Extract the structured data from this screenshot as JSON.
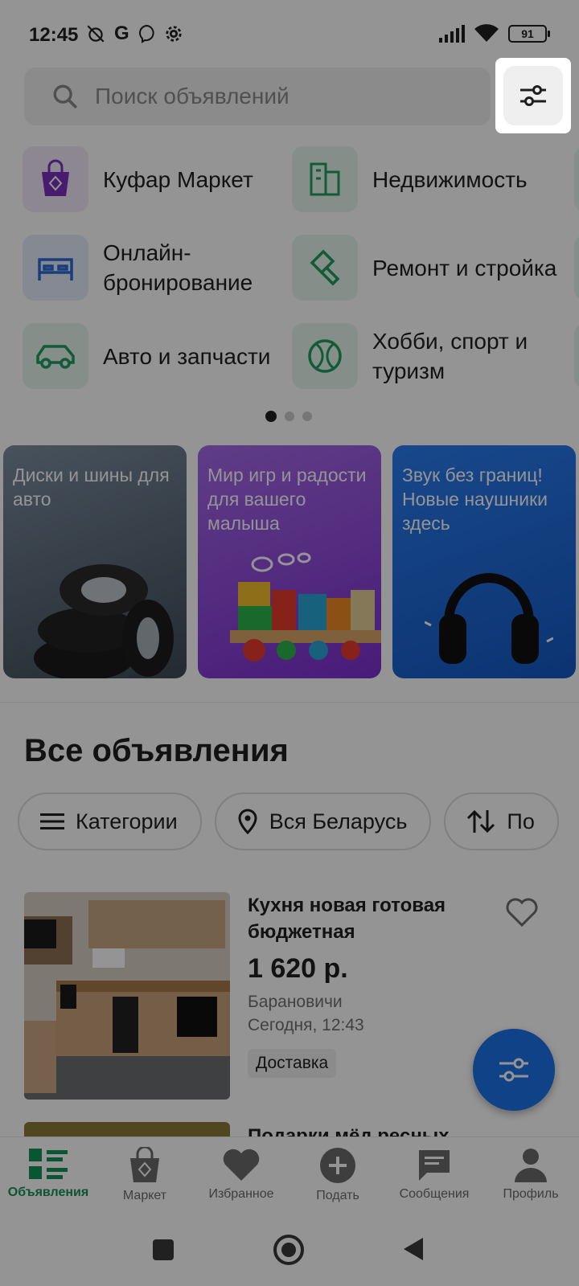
{
  "status_bar": {
    "time": "12:45",
    "battery": "91"
  },
  "search": {
    "placeholder": "Поиск объявлений"
  },
  "categories": [
    {
      "label": "Куфар Маркет",
      "icon": "market-bag-icon",
      "color": "#7b2fbe"
    },
    {
      "label": "Недвижимость",
      "icon": "building-icon",
      "color": "#1f9d61"
    },
    {
      "label": "Онлайн-бронирование",
      "icon": "bed-icon",
      "color": "#2a6bd6"
    },
    {
      "label": "Ремонт и стройка",
      "icon": "paint-roller-icon",
      "color": "#1f9d61"
    },
    {
      "label": "Авто и запчасти",
      "icon": "car-icon",
      "color": "#1f9d61"
    },
    {
      "label": "Хобби, спорт и туризм",
      "icon": "ball-icon",
      "color": "#1f9d61"
    }
  ],
  "banners": [
    {
      "text": "Диски и шины для авто",
      "color": "#5b6a7a"
    },
    {
      "text": "Мир игр и радости для вашего малыша",
      "color": "#8d3ed8"
    },
    {
      "text": "Звук без границ! Новые наушники здесь",
      "color": "#1b6fe0"
    }
  ],
  "section_title": "Все объявления",
  "filters": {
    "categories": "Категории",
    "location": "Вся Беларусь",
    "sort": "По"
  },
  "listing": {
    "title": "Кухня новая готовая бюджетная",
    "price": "1 620 р.",
    "city": "Барановичи",
    "date": "Сегодня, 12:43",
    "badge": "Доставка"
  },
  "listing2": {
    "title": "Подарки мёд ресных"
  },
  "bottom_nav": [
    {
      "label": "Объявления",
      "icon": "listings-icon"
    },
    {
      "label": "Маркет",
      "icon": "market-bag-icon"
    },
    {
      "label": "Избранное",
      "icon": "heart-icon"
    },
    {
      "label": "Подать",
      "icon": "plus-circle-icon"
    },
    {
      "label": "Сообщения",
      "icon": "chat-icon"
    },
    {
      "label": "Профиль",
      "icon": "profile-icon"
    }
  ],
  "colors": {
    "accent": "#15935a",
    "fab": "#1b73e8"
  }
}
